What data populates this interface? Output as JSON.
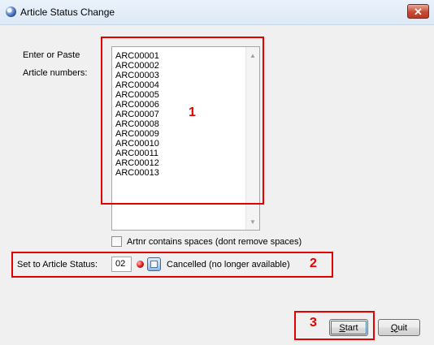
{
  "window": {
    "title": "Article Status Change",
    "close_glyph": "✕"
  },
  "form": {
    "enter_label_line1": "Enter or Paste",
    "enter_label_line2": "Article numbers:",
    "articles": [
      "ARC00001",
      "ARC00002",
      "ARC00003",
      "ARC00004",
      "ARC00005",
      "ARC00006",
      "ARC00007",
      "ARC00008",
      "ARC00009",
      "ARC00010",
      "ARC00011",
      "ARC00012",
      "ARC00013"
    ],
    "spaces_checkbox_label": "Artnr contains spaces (dont remove spaces)",
    "spaces_checked": false,
    "status_label": "Set to Article Status:",
    "status_value": "02",
    "status_description": "Cancelled (no longer available)"
  },
  "buttons": {
    "start_mnemonic": "S",
    "start_rest": "tart",
    "quit_mnemonic": "Q",
    "quit_rest": "uit"
  },
  "annotations": {
    "n1": "1",
    "n2": "2",
    "n3": "3",
    "color": "#e30000"
  },
  "icons": {
    "app": "globe-icon",
    "status_indicator": "red-dot-icon",
    "status_lookup": "lookup-icon"
  }
}
